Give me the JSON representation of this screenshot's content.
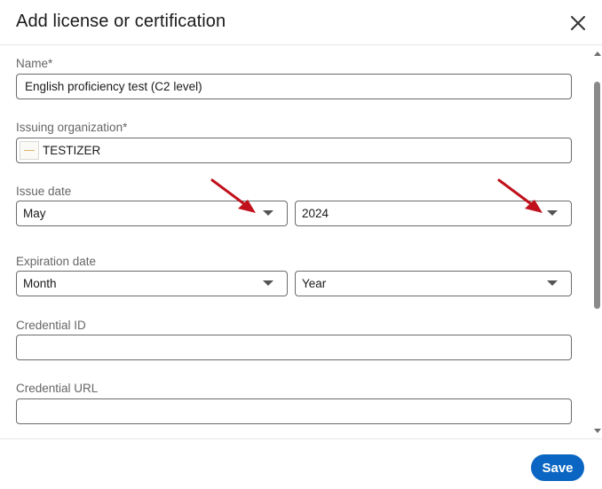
{
  "dialog": {
    "title": "Add license or certification"
  },
  "form": {
    "name": {
      "label": "Name*",
      "value": "English proficiency test (C2 level)"
    },
    "issuing_org": {
      "label": "Issuing organization*",
      "value": "TESTIZER"
    },
    "issue_date": {
      "label": "Issue date",
      "month": "May",
      "year": "2024"
    },
    "expiration_date": {
      "label": "Expiration date",
      "month": "Month",
      "year": "Year"
    },
    "credential_id": {
      "label": "Credential ID",
      "value": ""
    },
    "credential_url": {
      "label": "Credential URL",
      "value": ""
    }
  },
  "footer": {
    "save_label": "Save"
  },
  "colors": {
    "accent": "#0a66c2",
    "annotation_arrow": "#c0111c"
  },
  "icons": {
    "close": "close-icon",
    "caret": "chevron-down-icon",
    "annotation": "red-arrow-icon"
  }
}
